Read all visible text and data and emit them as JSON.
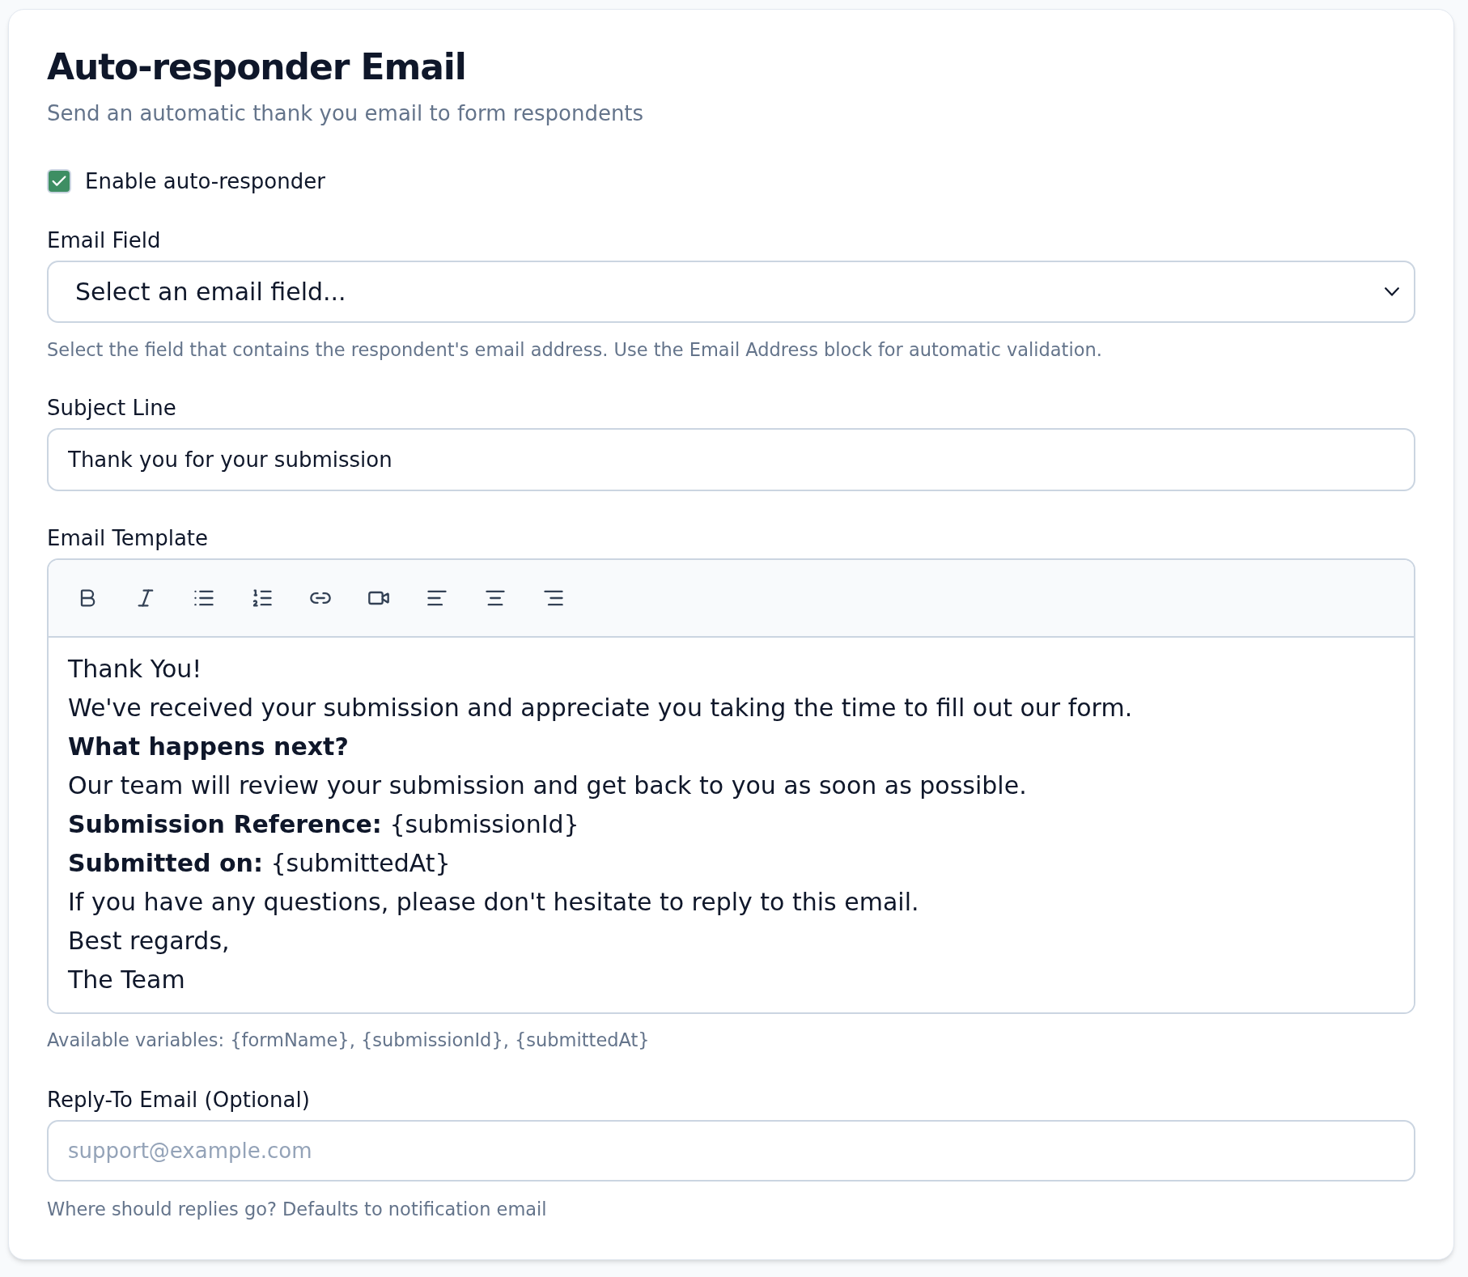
{
  "card": {
    "title": "Auto-responder Email",
    "subtitle": "Send an automatic thank you email to form respondents"
  },
  "enable": {
    "label": "Enable auto-responder",
    "checked": true
  },
  "email_field": {
    "label": "Email Field",
    "value": "Select an email field...",
    "help": "Select the field that contains the respondent's email address. Use the Email Address block for automatic validation."
  },
  "subject": {
    "label": "Subject Line",
    "value": "Thank you for your submission"
  },
  "template": {
    "label": "Email Template",
    "lines": [
      {
        "kind": "text",
        "text": "Thank You!"
      },
      {
        "kind": "text",
        "text": "We've received your submission and appreciate you taking the time to fill out our form."
      },
      {
        "kind": "heading",
        "text": "What happens next?"
      },
      {
        "kind": "text",
        "text": "Our team will review your submission and get back to you as soon as possible."
      },
      {
        "kind": "text",
        "text": "**Submission Reference:** {submissionId}"
      },
      {
        "kind": "text",
        "text": "**Submitted on:** {submittedAt}"
      },
      {
        "kind": "text",
        "text": "If you have any questions, please don't hesitate to reply to this email."
      },
      {
        "kind": "text",
        "text": "Best regards,"
      },
      {
        "kind": "text",
        "text": "The Team"
      }
    ],
    "help": "Available variables: {formName}, {submissionId}, {submittedAt}"
  },
  "reply_to": {
    "label": "Reply-To Email (Optional)",
    "placeholder": "support@example.com",
    "help": "Where should replies go? Defaults to notification email"
  }
}
